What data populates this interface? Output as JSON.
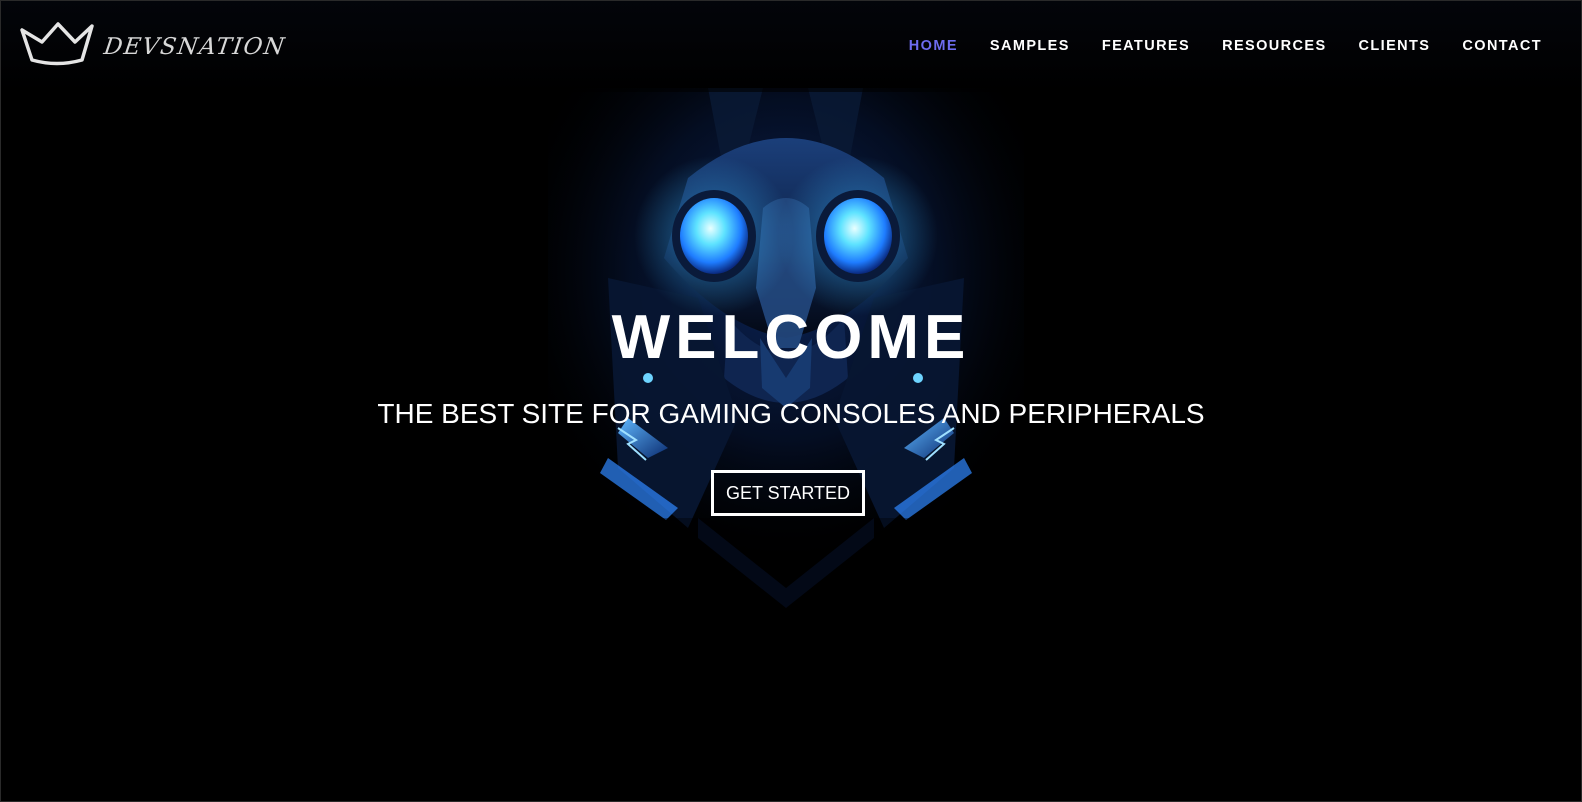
{
  "brand": {
    "logo_text": "DEVSNATION",
    "logo_icon": "crown-icon"
  },
  "nav": {
    "items": [
      {
        "label": "HOME",
        "active": true
      },
      {
        "label": "SAMPLES",
        "active": false
      },
      {
        "label": "FEATURES",
        "active": false
      },
      {
        "label": "RESOURCES",
        "active": false
      },
      {
        "label": "CLIENTS",
        "active": false
      },
      {
        "label": "CONTACT",
        "active": false
      }
    ]
  },
  "hero": {
    "title": "WELCOME",
    "subtitle": "THE BEST SITE FOR GAMING CONSOLES AND PERIPHERALS",
    "cta_label": "GET STARTED",
    "art_icon": "robot-helmet-artwork"
  },
  "colors": {
    "background": "#000000",
    "nav_active": "#6e6cf0",
    "text": "#ffffff",
    "glow": "#36a8ff"
  }
}
